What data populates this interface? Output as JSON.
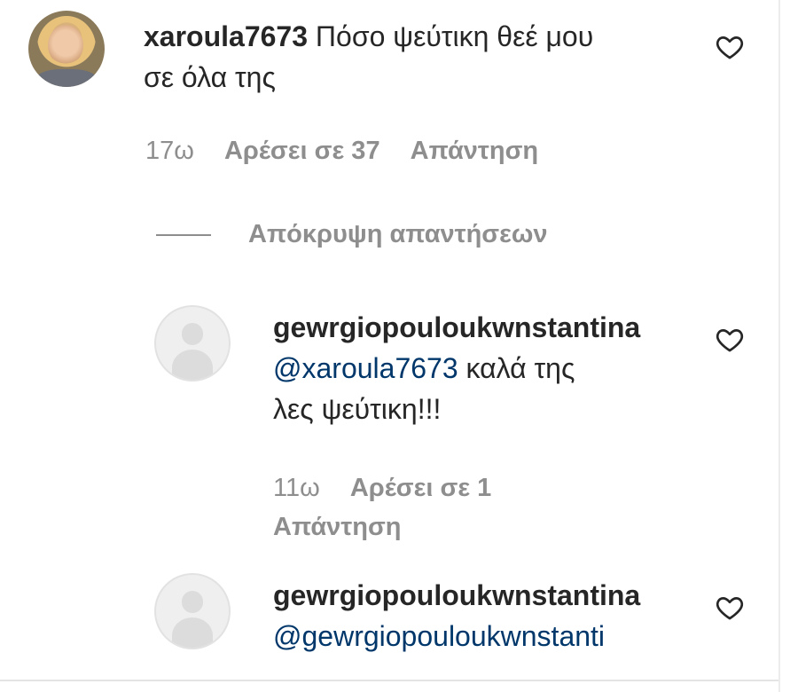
{
  "comments": [
    {
      "username": "xaroula7673",
      "text_line1": "Πόσο ψεύτικη θεέ μου",
      "text_line2": "σε όλα της",
      "age": "17ω",
      "likes": "Αρέσει σε 37",
      "reply_label": "Απάντηση",
      "avatar": "user-photo",
      "like_icon": "heart-outline-icon"
    }
  ],
  "hide_replies_label": "Απόκρυψη απαντήσεων",
  "replies": [
    {
      "username": "gewrgiopouloukwnstantina",
      "mention": "@xaroula7673",
      "text_line1_rest": " καλά της",
      "text_line2": "λες ψεύτικη!!!",
      "age": "11ω",
      "likes": "Αρέσει σε 1",
      "reply_label": "Απάντηση",
      "avatar": "default-avatar",
      "like_icon": "heart-outline-icon"
    },
    {
      "username": "gewrgiopouloukwnstantina",
      "mention": "@gewrgiopouloukwnstanti",
      "avatar": "default-avatar",
      "like_icon": "heart-outline-icon"
    }
  ]
}
